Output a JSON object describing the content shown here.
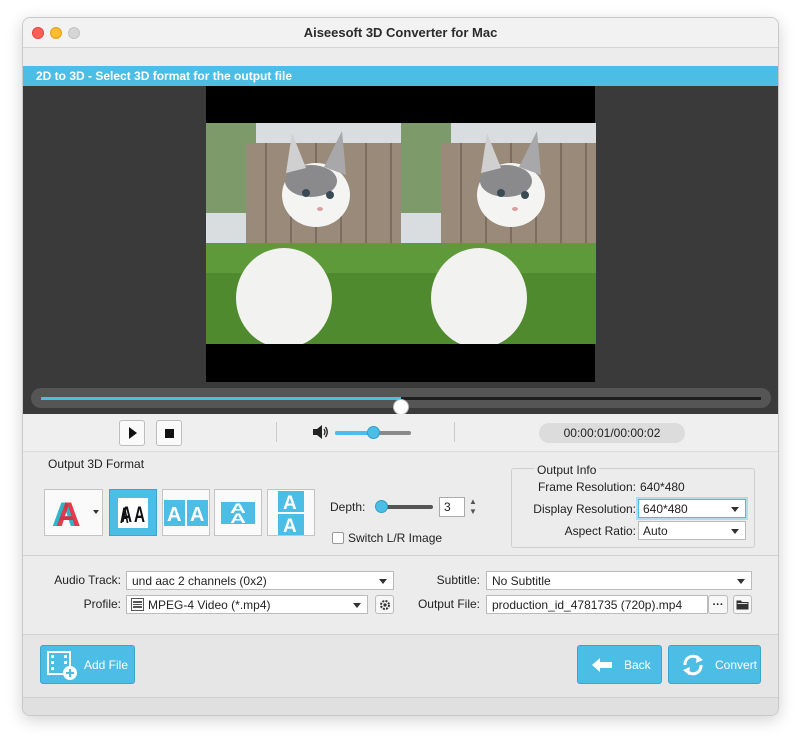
{
  "window": {
    "title": "Aiseesoft 3D Converter for Mac"
  },
  "banner": {
    "text": "2D to 3D - Select 3D format for the output file"
  },
  "playback": {
    "time": "00:00:01/00:00:02",
    "progress": 0.5,
    "volume": 0.5
  },
  "output_format": {
    "section_label": "Output 3D Format",
    "buttons": [
      {
        "name": "anaglyph",
        "icon": "anaglyph-icon",
        "selected": false
      },
      {
        "name": "side-by-side-half",
        "icon": "side-by-side-half-icon",
        "selected": true
      },
      {
        "name": "side-by-side-full",
        "icon": "side-by-side-full-icon",
        "selected": false
      },
      {
        "name": "top-bottom-half",
        "icon": "top-bottom-half-icon",
        "selected": false
      },
      {
        "name": "top-bottom-full",
        "icon": "top-bottom-full-icon",
        "selected": false
      }
    ],
    "depth_label": "Depth:",
    "depth_value": "3",
    "switch_label": "Switch L/R Image"
  },
  "output_info": {
    "title": "Output Info",
    "frame_resolution_label": "Frame Resolution:",
    "frame_resolution_value": "640*480",
    "display_resolution_label": "Display Resolution:",
    "display_resolution_value": "640*480",
    "aspect_ratio_label": "Aspect Ratio:",
    "aspect_ratio_value": "Auto"
  },
  "output": {
    "audio_track_label": "Audio Track:",
    "audio_track_value": "und aac 2 channels (0x2)",
    "profile_label": "Profile:",
    "profile_value": "MPEG-4 Video (*.mp4)",
    "subtitle_label": "Subtitle:",
    "subtitle_value": "No Subtitle",
    "output_file_label": "Output File:",
    "output_file_value": "production_id_4781735 (720p).mp4",
    "browse_label": "···"
  },
  "actions": {
    "add_file": "Add File",
    "back": "Back",
    "convert": "Convert"
  },
  "colors": {
    "accent": "#4cbde4",
    "close": "#fe5f57",
    "minimize": "#febc2e"
  }
}
